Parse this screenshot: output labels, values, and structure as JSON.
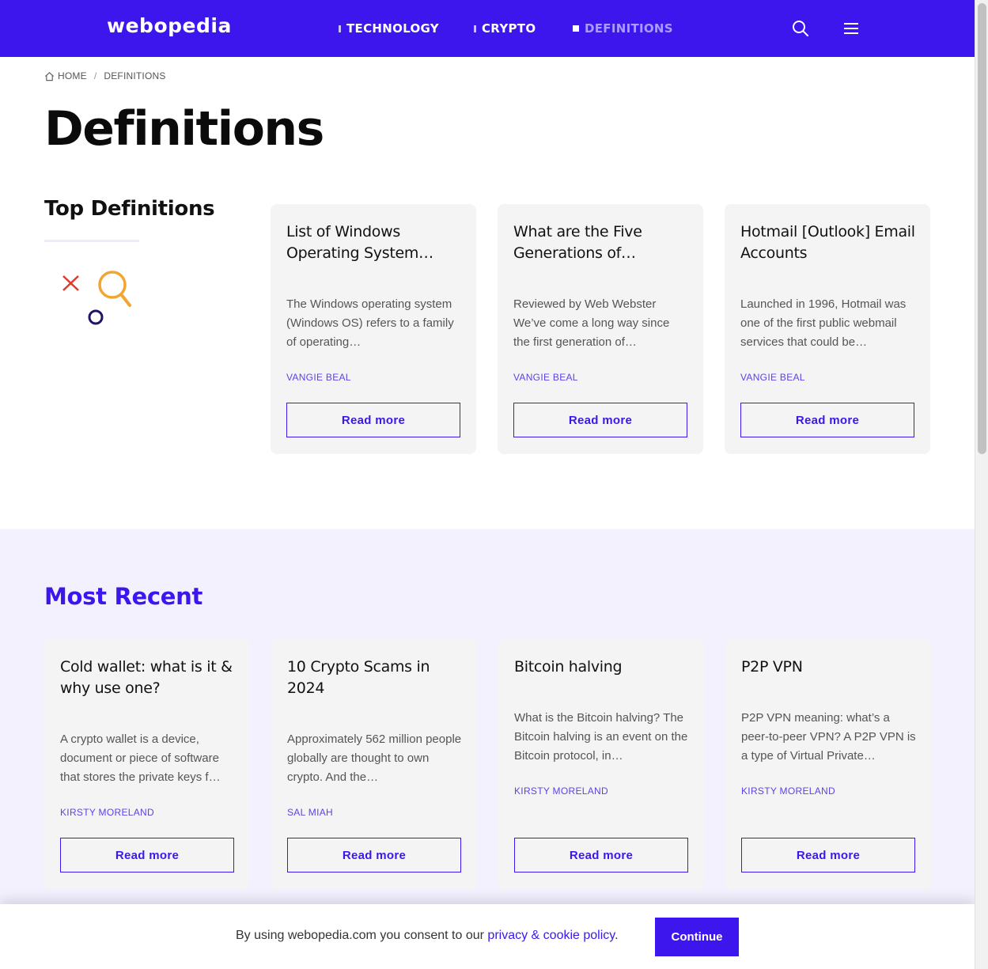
{
  "header": {
    "logo": "webopedia",
    "nav": [
      {
        "label": "TECHNOLOGY"
      },
      {
        "label": "CRYPTO"
      },
      {
        "label": "DEFINITIONS"
      }
    ]
  },
  "breadcrumb": {
    "home": "HOME",
    "separator": "/",
    "current": "DEFINITIONS"
  },
  "page_title": "Definitions",
  "top_definitions": {
    "heading": "Top Definitions",
    "cards": [
      {
        "title": "List of Windows Operating System…",
        "excerpt": "The Windows operating system (Windows OS) refers to a family of operating…",
        "author": "VANGIE BEAL",
        "button": "Read more"
      },
      {
        "title": "What are the Five Generations of…",
        "excerpt": "Reviewed by Web Webster We’ve come a long way since the first generation of…",
        "author": "VANGIE BEAL",
        "button": "Read more"
      },
      {
        "title": "Hotmail [Outlook] Email Accounts",
        "excerpt": "Launched in 1996, Hotmail was one of the first public webmail services that could be…",
        "author": "VANGIE BEAL",
        "button": "Read more"
      }
    ]
  },
  "most_recent": {
    "heading": "Most Recent",
    "cards": [
      {
        "title": "Cold wallet: what is it & why use one?",
        "excerpt": "A crypto wallet is a device, document or piece of software that stores the private keys f…",
        "author": "KIRSTY MORELAND",
        "button": "Read more"
      },
      {
        "title": "10 Crypto Scams in 2024",
        "excerpt": "Approximately 562 million people globally are thought to own crypto. And the…",
        "author": "SAL MIAH",
        "button": "Read more"
      },
      {
        "title": "Bitcoin halving",
        "excerpt": "What is the Bitcoin halving? The Bitcoin halving is an event on the Bitcoin protocol, in…",
        "author": "KIRSTY MORELAND",
        "button": "Read more"
      },
      {
        "title": "P2P VPN",
        "excerpt": "P2P VPN meaning: what’s a peer-to-peer VPN? A P2P VPN is a type of Virtual Private…",
        "author": "KIRSTY MORELAND",
        "button": "Read more"
      }
    ]
  },
  "cookie_banner": {
    "text": "By using webopedia.com you consent to our ",
    "link": "privacy & cookie policy",
    "suffix": ".",
    "button": "Continue"
  },
  "icons": {
    "search": "search-icon",
    "menu": "hamburger-menu-icon",
    "home": "home-icon"
  },
  "colors": {
    "brand": "#3d16ee",
    "card_bg": "#f4f4f4",
    "section_bg": "#f3f1fe"
  }
}
